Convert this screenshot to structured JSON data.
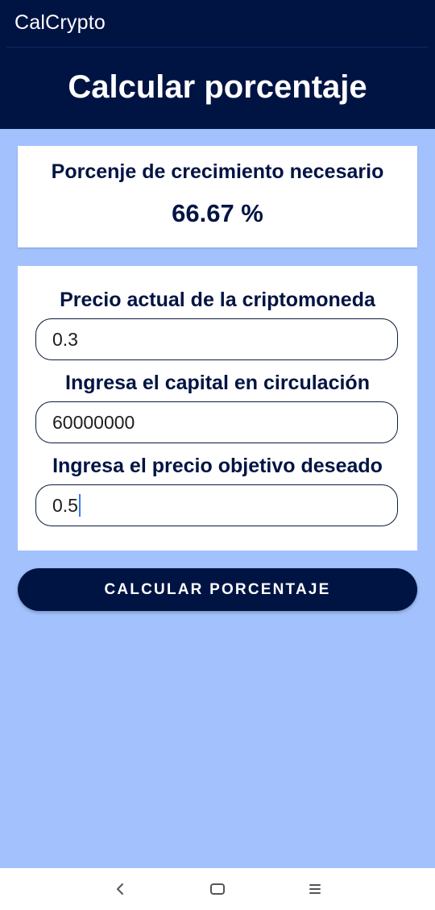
{
  "app": {
    "name": "CalCrypto",
    "title": "Calcular porcentaje"
  },
  "result": {
    "label": "Porcenje de crecimiento necesario",
    "value": "66.67 %"
  },
  "form": {
    "fields": [
      {
        "label": "Precio actual de la criptomoneda",
        "value": "0.3"
      },
      {
        "label": "Ingresa el capital en circulación",
        "value": "60000000"
      },
      {
        "label": "Ingresa el precio objetivo deseado",
        "value": "0.5"
      }
    ]
  },
  "button": {
    "label": "CALCULAR PORCENTAJE"
  },
  "navbar": {
    "icons": [
      "back-icon",
      "home-icon",
      "menu-icon"
    ]
  },
  "colors": {
    "primary": "#001443",
    "background": "#a3c2fd",
    "card": "#ffffff",
    "caret": "#3a7bf0"
  }
}
